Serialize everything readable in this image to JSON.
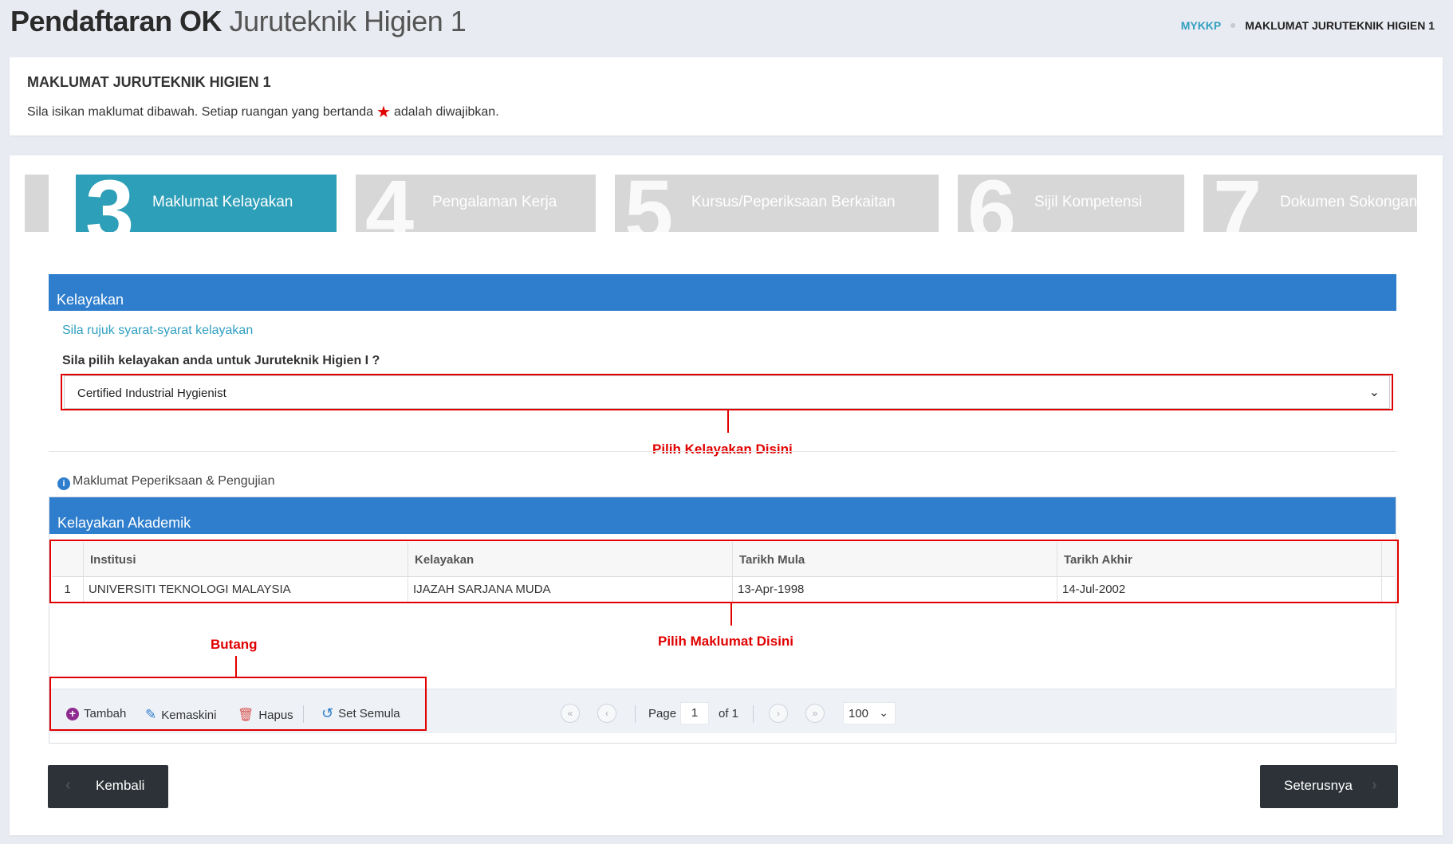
{
  "header": {
    "title_bold": "Pendaftaran OK",
    "title_light": "Juruteknik Higien 1",
    "breadcrumb": {
      "link": "MYKKP",
      "current": "MAKLUMAT JURUTEKNIK HIGIEN 1"
    }
  },
  "info_card": {
    "heading": "MAKLUMAT JURUTEKNIK HIGIEN 1",
    "text_before": "Sila isikan maklumat dibawah. Setiap ruangan yang bertanda",
    "star": "★",
    "text_after": "adalah diwajibkan."
  },
  "steps": [
    {
      "number": "3",
      "label": "Maklumat Kelayakan",
      "active": true
    },
    {
      "number": "4",
      "label": "Pengalaman Kerja",
      "active": false
    },
    {
      "number": "5",
      "label": "Kursus/Peperiksaan Berkaitan",
      "active": false
    },
    {
      "number": "6",
      "label": "Sijil Kompetensi",
      "active": false
    },
    {
      "number": "7",
      "label": "Dokumen Sokongan",
      "active": false
    }
  ],
  "kelayakan": {
    "section_title": "Kelayakan",
    "link": "Sila rujuk syarat-syarat kelayakan",
    "question": "Sila pilih kelayakan anda untuk Juruteknik Higien I ?",
    "selected": "Certified Industrial Hygienist"
  },
  "annotations": {
    "select": "Pilih Kelayakan Disini",
    "grid": "Pilih Maklumat Disini",
    "buttons": "Butang"
  },
  "exam_info": {
    "icon": "i",
    "label": "Maklumat Peperiksaan & Pengujian"
  },
  "academic": {
    "section_title": "Kelayakan Akademik",
    "columns": [
      "Institusi",
      "Kelayakan",
      "Tarikh Mula",
      "Tarikh Akhir"
    ],
    "rows": [
      {
        "no": "1",
        "institusi": "UNIVERSITI TEKNOLOGI MALAYSIA",
        "kelayakan": "IJAZAH SARJANA MUDA",
        "mula": "13-Apr-1998",
        "akhir": "14-Jul-2002"
      }
    ]
  },
  "toolbar": {
    "add": "Tambah",
    "edit": "Kemaskini",
    "delete": "Hapus",
    "reset": "Set Semula",
    "page_label": "Page",
    "page_value": "1",
    "page_of": "of 1",
    "page_size": "100"
  },
  "nav": {
    "back": "Kembali",
    "next": "Seterusnya"
  },
  "colors": {
    "step_active": "#2e9fb8",
    "section_header": "#2f7ecd",
    "annotation": "#e00000",
    "button_dark": "#2d3238"
  }
}
